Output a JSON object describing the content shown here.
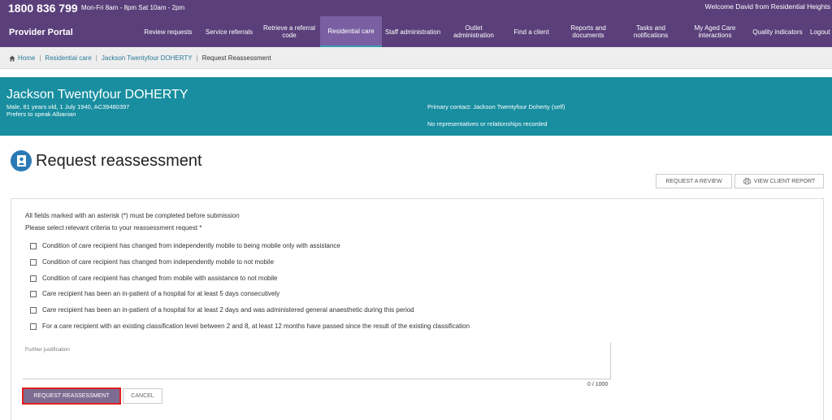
{
  "top_strip": {
    "phone": "1800 836 799",
    "hours": "Mon-Fri 8am - 8pm Sat 10am - 2pm",
    "welcome": "Welcome David from Residential Heights"
  },
  "nav": {
    "portal_title": "Provider Portal",
    "items": [
      {
        "label": "Review requests"
      },
      {
        "label": "Service referrals"
      },
      {
        "label": "Retrieve a referral code"
      },
      {
        "label": "Residential care"
      },
      {
        "label": "Staff administration"
      },
      {
        "label": "Outlet administration"
      },
      {
        "label": "Find a client"
      },
      {
        "label": "Reports and documents"
      },
      {
        "label": "Tasks and notifications"
      },
      {
        "label": "My Aged Care interactions"
      },
      {
        "label": "Quality indicators"
      },
      {
        "label": "Logout"
      }
    ],
    "active_index": 3
  },
  "breadcrumb": {
    "home": "Home",
    "residential": "Residential care",
    "client": "Jackson Twentyfour DOHERTY",
    "current": "Request Reassessment"
  },
  "client": {
    "name": "Jackson Twentyfour DOHERTY",
    "details": "Male, 81 years old, 1 July 1940, AC39480397",
    "language": "Prefers to speak Albanian",
    "primary_contact": "Primary contact: Jackson Twentyfour Doherty (self)",
    "representatives": "No representatives or relationships recorded"
  },
  "page": {
    "title": "Request reassessment",
    "request_review_label": "REQUEST A REVIEW",
    "view_report_label": "VIEW CLIENT REPORT"
  },
  "form": {
    "instruction": "All fields marked with an asterisk (*) must be completed before submission",
    "criteria_prompt": "Please select relevant criteria to your reassessment request *",
    "criteria": [
      {
        "label": "Condition of care recipient has changed from independently mobile to being mobile only with assistance",
        "checked": false
      },
      {
        "label": "Condition of care recipient has changed from independently mobile to not mobile",
        "checked": false
      },
      {
        "label": "Condition of care recipient has changed from mobile with assistance to not mobile",
        "checked": false
      },
      {
        "label": "Care recipient has been an in-patient of a hospital for at least 5 days consecutively",
        "checked": false
      },
      {
        "label": "Care recipient has been an in-patient of a hospital for at least 2 days and was administered general anaesthetic during this period",
        "checked": false
      },
      {
        "label": "For a care recipient with an existing classification level between 2 and 8, at least 12 months have passed since the result of the existing classification",
        "checked": false
      }
    ],
    "justification_label": "Further justification",
    "justification_value": "",
    "char_count": "0 / 1000",
    "submit_label": "REQUEST REASSESSMENT",
    "cancel_label": "CANCEL"
  },
  "colors": {
    "nav_bg": "#5a3f7a",
    "nav_active": "#7a5fa2",
    "banner_bg": "#188ea0",
    "link": "#2a7a9a",
    "submit_bg": "#7d6c92",
    "highlight": "#e02020"
  }
}
